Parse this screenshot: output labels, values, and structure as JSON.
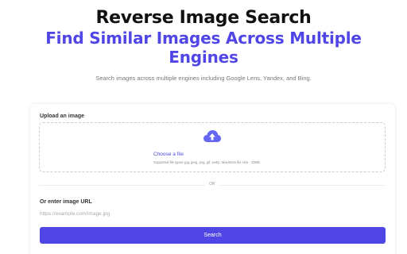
{
  "hero": {
    "title": "Reverse Image Search",
    "subtitle": "Find Similar Images Across Multiple Engines",
    "description": "Search images across multiple engines including Google Lens, Yandex, and Bing."
  },
  "upload": {
    "label": "Upload an image",
    "choose_file": "Choose a file",
    "supported_types": "Supported file types: jpg, jpeg, png, gif, webp. Maximum file size - 10MB.",
    "icon": "cloud-upload-icon"
  },
  "divider": {
    "text": "OR"
  },
  "url": {
    "label": "Or enter image URL",
    "placeholder": "https://example.com/image.jpg",
    "value": ""
  },
  "actions": {
    "search_label": "Search"
  },
  "colors": {
    "accent": "#4f46e5",
    "title": "#111111",
    "icon": "#6366f1"
  }
}
